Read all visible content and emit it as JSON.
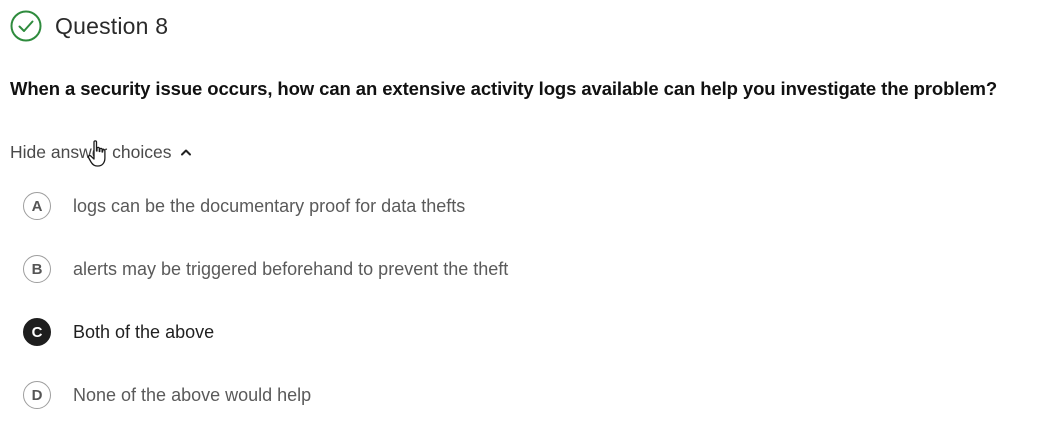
{
  "question": {
    "title": "Question 8",
    "status_icon": "check-circle-icon",
    "status_color": "#2e8b3d",
    "prompt": "When a security issue occurs, how can an extensive activity logs available can help you investigate the problem?"
  },
  "toggle": {
    "label": "Hide answer choices",
    "icon": "chevron-up-icon"
  },
  "choices": [
    {
      "letter": "A",
      "text": "logs can be the documentary proof for data thefts",
      "selected": false
    },
    {
      "letter": "B",
      "text": "alerts may be triggered beforehand to prevent the theft",
      "selected": false
    },
    {
      "letter": "C",
      "text": "Both of the above",
      "selected": true
    },
    {
      "letter": "D",
      "text": "None of the above would help",
      "selected": false
    }
  ]
}
